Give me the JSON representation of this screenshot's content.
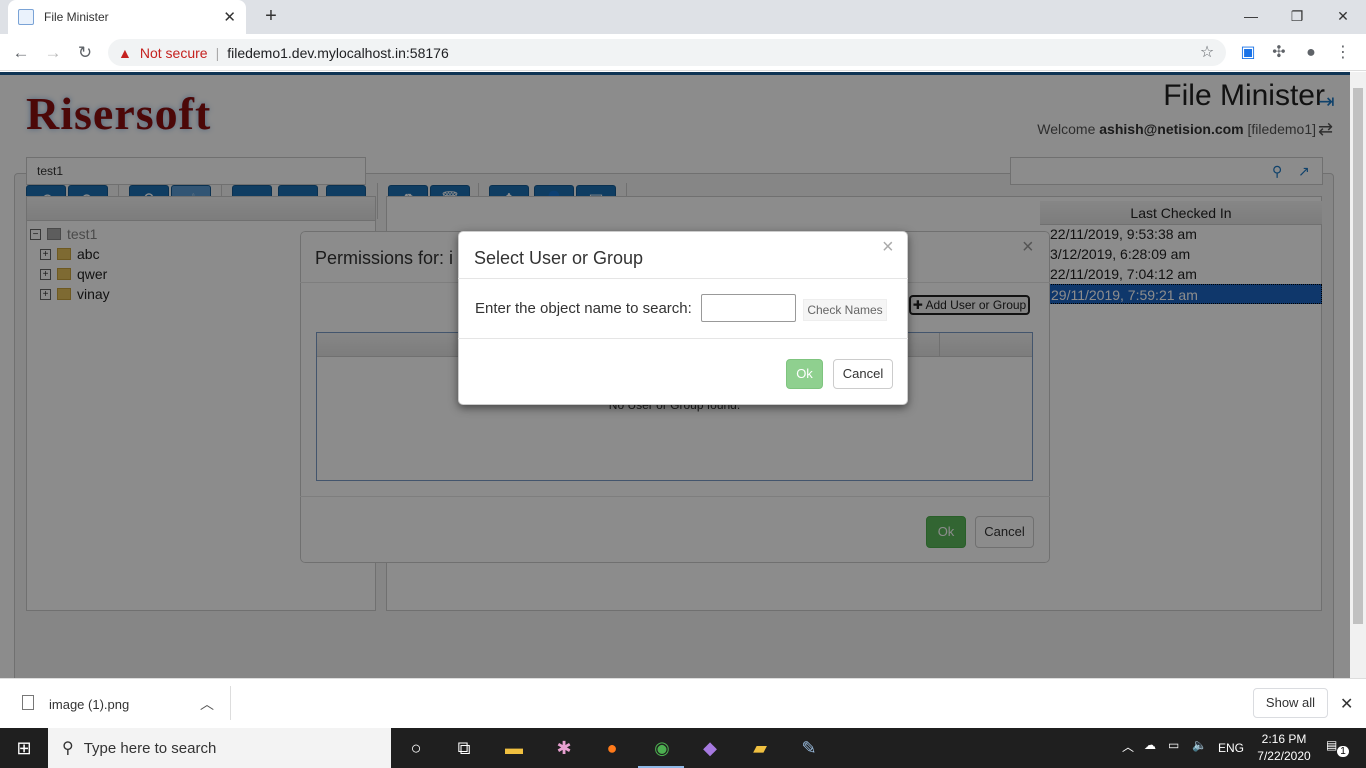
{
  "browser": {
    "tab_title": "File Minister",
    "not_secure": "Not secure",
    "url": "filedemo1.dev.mylocalhost.in:58176"
  },
  "app": {
    "logo": "Risersoft",
    "title": "File Minister",
    "welcome_prefix": "Welcome",
    "user": "ashish@netision.com",
    "org": "[filedemo1]",
    "path_value": "test1"
  },
  "tree": {
    "root": "test1",
    "items": [
      "abc",
      "qwer",
      "vinay"
    ]
  },
  "list": {
    "column_last_checked_in": "Last Checked In",
    "rows": [
      "22/11/2019, 9:53:38 am",
      "3/12/2019, 6:28:09 am",
      "22/11/2019, 7:04:12 am",
      "29/11/2019, 7:59:21 am"
    ],
    "selected_index": 3
  },
  "permissions_modal": {
    "title": "Permissions for: i",
    "add_button": "Add User or Group",
    "empty_text": "No User or Group found.",
    "ok": "Ok",
    "cancel": "Cancel"
  },
  "select_modal": {
    "title": "Select User or Group",
    "label": "Enter the object name to search:",
    "input_value": "",
    "check_names": "Check Names",
    "ok": "Ok",
    "cancel": "Cancel"
  },
  "download_bar": {
    "file": "image (1).png",
    "show_all": "Show all"
  },
  "taskbar": {
    "search_placeholder": "Type here to search",
    "lang": "ENG",
    "time": "2:16 PM",
    "date": "7/22/2020",
    "notification_count": "1"
  }
}
